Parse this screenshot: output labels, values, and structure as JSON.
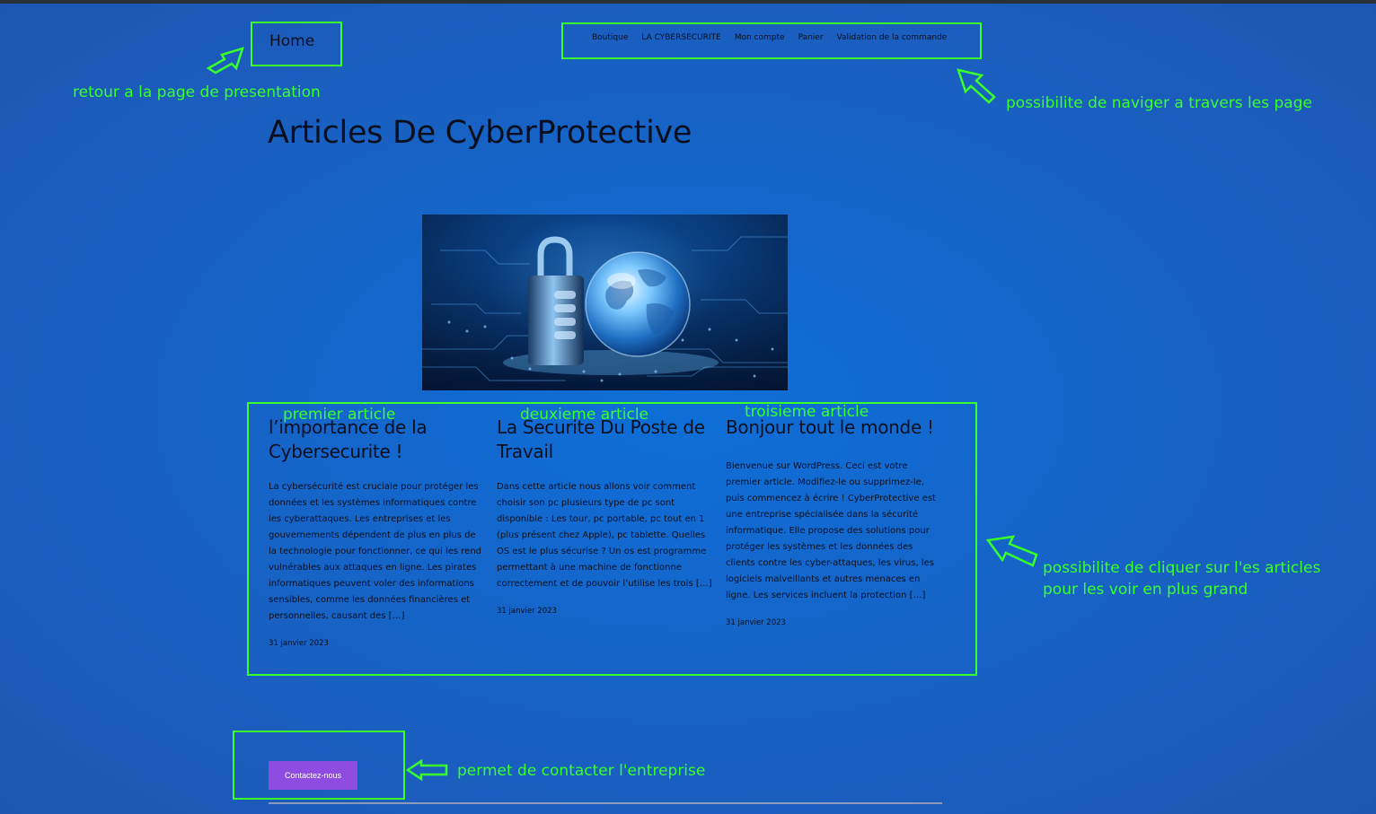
{
  "header": {
    "home_label": "Home",
    "nav": [
      "Boutique",
      "LA CYBERSECURITE",
      "Mon compte",
      "Panier",
      "Validation de la commande"
    ]
  },
  "page_title": "Articles De CyberProtective",
  "articles": [
    {
      "title": "l’importance de la Cybersecurite !",
      "excerpt": "La cybersécurité est cruciale pour protéger les données et les systèmes informatiques contre les cyberattaques. Les entreprises et les gouvernements dépendent de plus en plus de la technologie pour fonctionner, ce qui les rend vulnérables aux attaques en ligne. Les pirates informatiques peuvent voler des informations sensibles, comme les données financières et personnelles, causant des […]",
      "date": "31 janvier 2023"
    },
    {
      "title": "La Securite Du Poste de Travail",
      "excerpt": "Dans cette article nous allons voir comment choisir son pc plusieurs type de pc sont disponible : Les tour, pc portable, pc tout en 1 (plus présent chez Apple), pc tablette. Quelles OS est le plus sécurise ? Un os est programme permettant à une machine de fonctionne correctement et de pouvoir l’utilise les trois […]",
      "date": "31 janvier 2023"
    },
    {
      "title": "Bonjour tout le monde !",
      "excerpt": "Bienvenue sur WordPress. Ceci est votre premier article. Modifiez-le ou supprimez-le, puis commencez à écrire ! CyberProtective est une entreprise spécialisée dans la sécurité informatique. Elle propose des solutions pour protéger les systèmes et les données des clients contre les cyber-attaques, les virus, les logiciels malveillants et autres menaces en ligne. Les services incluent la protection […]",
      "date": "31 janvier 2023"
    }
  ],
  "contact_label": "Contactez-nous",
  "annotations": {
    "home": "retour a la page de presentation",
    "nav": "possibilite de naviger a travers les page",
    "article1": "premier article",
    "article2": "deuxieme article",
    "article3": "troisieme article",
    "articles_line1": "possibilite de cliquer sur l'es articles",
    "articles_line2": "pour les voir en plus grand",
    "contact": "permet de contacter l'entreprise"
  },
  "colors": {
    "annotation": "#39ff2a",
    "background": "#1565c9",
    "button": "#8e4de0"
  },
  "hero_image": "padlock-and-glass-globe-on-circuit-board"
}
